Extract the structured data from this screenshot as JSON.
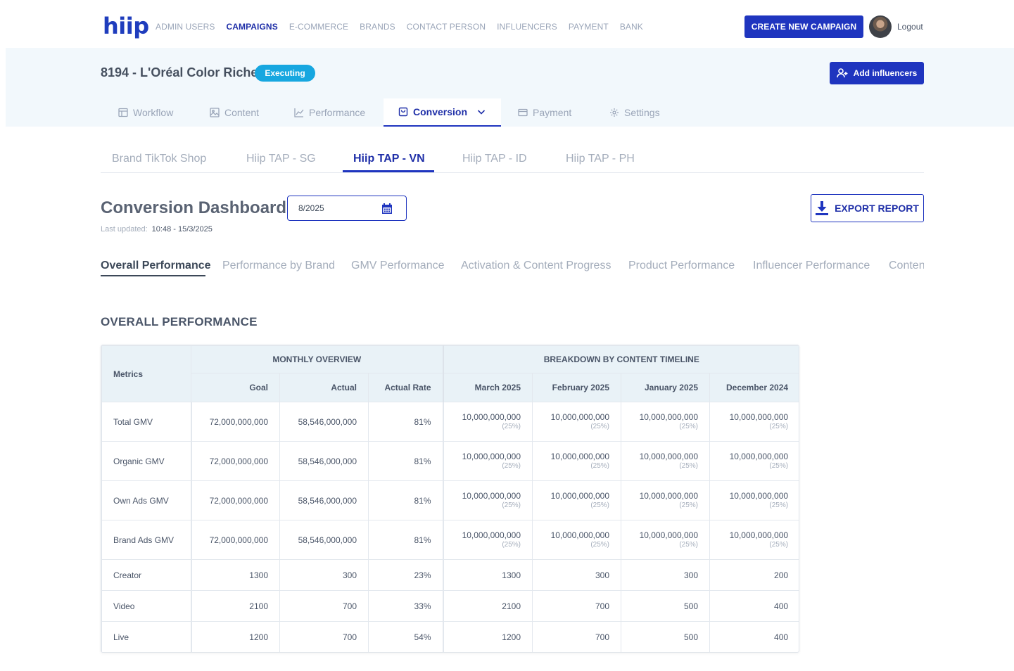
{
  "nav": {
    "logo": "hiip",
    "items": [
      "ADMIN USERS",
      "CAMPAIGNS",
      "E-COMMERCE",
      "BRANDS",
      "CONTACT PERSON",
      "INFLUENCERS",
      "PAYMENT",
      "BANK"
    ],
    "active": "CAMPAIGNS",
    "create_label": "CREATE NEW CAMPAIGN",
    "logout_label": "Logout"
  },
  "campaign": {
    "title": "8194 - L'Oréal Color Riche",
    "status": "Executing",
    "add_label": "Add influencers"
  },
  "main_tabs": [
    {
      "label": "Workflow",
      "icon": "table-icon"
    },
    {
      "label": "Content",
      "icon": "image-icon"
    },
    {
      "label": "Performance",
      "icon": "chart-icon"
    },
    {
      "label": "Conversion",
      "icon": "bag-icon",
      "active": true
    },
    {
      "label": "Payment",
      "icon": "card-icon"
    },
    {
      "label": "Settings",
      "icon": "gear-icon"
    }
  ],
  "sub_tabs": [
    "Brand TikTok Shop",
    "Hiip TAP - SG",
    "Hiip TAP - VN",
    "Hiip TAP - ID",
    "Hiip TAP - PH"
  ],
  "sub_tab_active": "Hiip TAP - VN",
  "dashboard": {
    "title": "Conversion Dashboard",
    "date_value": "8/2025",
    "last_updated_label": "Last updated:",
    "last_updated_value": "10:48 - 15/3/2025",
    "export_label": "EXPORT REPORT"
  },
  "section_tabs": [
    "Overall Performance",
    "Performance by Brand",
    "GMV Performance",
    "Activation & Content Progress",
    "Product Performance",
    "Influencer Performance",
    "Conten"
  ],
  "section_heading": "OVERALL PERFORMANCE",
  "table": {
    "metrics_header": "Metrics",
    "group_monthly": "MONTHLY OVERVIEW",
    "group_breakdown": "BREAKDOWN BY CONTENT TIMELINE",
    "columns": [
      "Goal",
      "Actual",
      "Actual Rate",
      "March 2025",
      "February 2025",
      "January 2025",
      "December 2024"
    ],
    "rows": [
      {
        "metric": "Total GMV",
        "goal": "72,000,000,000",
        "actual": "58,546,000,000",
        "rate": "81%",
        "breakdown": [
          {
            "v": "10,000,000,000",
            "p": "(25%)"
          },
          {
            "v": "10,000,000,000",
            "p": "(25%)"
          },
          {
            "v": "10,000,000,000",
            "p": "(25%)"
          },
          {
            "v": "10,000,000,000",
            "p": "(25%)"
          }
        ]
      },
      {
        "metric": "Organic GMV",
        "goal": "72,000,000,000",
        "actual": "58,546,000,000",
        "rate": "81%",
        "breakdown": [
          {
            "v": "10,000,000,000",
            "p": "(25%)"
          },
          {
            "v": "10,000,000,000",
            "p": "(25%)"
          },
          {
            "v": "10,000,000,000",
            "p": "(25%)"
          },
          {
            "v": "10,000,000,000",
            "p": "(25%)"
          }
        ]
      },
      {
        "metric": "Own Ads GMV",
        "goal": "72,000,000,000",
        "actual": "58,546,000,000",
        "rate": "81%",
        "breakdown": [
          {
            "v": "10,000,000,000",
            "p": "(25%)"
          },
          {
            "v": "10,000,000,000",
            "p": "(25%)"
          },
          {
            "v": "10,000,000,000",
            "p": "(25%)"
          },
          {
            "v": "10,000,000,000",
            "p": "(25%)"
          }
        ]
      },
      {
        "metric": "Brand Ads GMV",
        "goal": "72,000,000,000",
        "actual": "58,546,000,000",
        "rate": "81%",
        "breakdown": [
          {
            "v": "10,000,000,000",
            "p": "(25%)"
          },
          {
            "v": "10,000,000,000",
            "p": "(25%)"
          },
          {
            "v": "10,000,000,000",
            "p": "(25%)"
          },
          {
            "v": "10,000,000,000",
            "p": "(25%)"
          }
        ]
      },
      {
        "metric": "Creator",
        "goal": "1300",
        "actual": "300",
        "rate": "23%",
        "breakdown": [
          {
            "v": "1300"
          },
          {
            "v": "300"
          },
          {
            "v": "300"
          },
          {
            "v": "200"
          }
        ]
      },
      {
        "metric": "Video",
        "goal": "2100",
        "actual": "700",
        "rate": "33%",
        "breakdown": [
          {
            "v": "2100"
          },
          {
            "v": "700"
          },
          {
            "v": "500"
          },
          {
            "v": "400"
          }
        ]
      },
      {
        "metric": "Live",
        "goal": "1200",
        "actual": "700",
        "rate": "54%",
        "breakdown": [
          {
            "v": "1200"
          },
          {
            "v": "700"
          },
          {
            "v": "500"
          },
          {
            "v": "400"
          }
        ]
      }
    ]
  },
  "colors": {
    "brand": "#1f35bf",
    "status": "#17a7e0",
    "band": "#f2f8fc"
  }
}
